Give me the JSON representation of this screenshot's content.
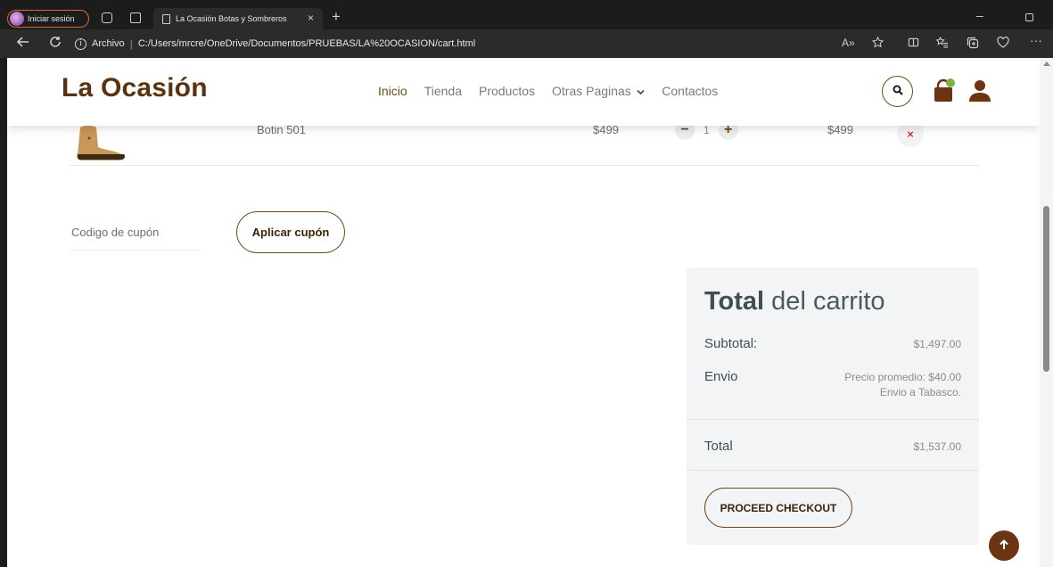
{
  "browser": {
    "profile_label": "Iniciar sesión",
    "tab_title": "La Ocasión Botas y Sombreros",
    "tab_close": "×",
    "new_tab": "+",
    "url_badge": "Archivo",
    "url_separator": "|",
    "url": "C:/Users/mrcre/OneDrive/Documentos/PRUEBAS/LA%20OCASION/cart.html",
    "read_aloud": "A»",
    "minimize": "–"
  },
  "header": {
    "logo": "La Ocasión",
    "nav": [
      {
        "label": "Inicio"
      },
      {
        "label": "Tienda"
      },
      {
        "label": "Productos"
      },
      {
        "label": "Otras Paginas"
      },
      {
        "label": "Contactos"
      }
    ]
  },
  "cart": {
    "items": [
      {
        "name": "Botin 501",
        "price": "$499",
        "quantity": "1",
        "total": "$499"
      }
    ],
    "qty_minus": "−",
    "qty_plus": "+",
    "remove": "×"
  },
  "coupon": {
    "placeholder": "Codigo de cupón",
    "apply_label": "Aplicar cupón"
  },
  "totals": {
    "title_bold": "Total",
    "title_rest": " del carrito",
    "subtotal_label": "Subtotal:",
    "subtotal_value": "$1,497.00",
    "shipping_label": "Envio",
    "shipping_line1": "Precio promedio: $40.00",
    "shipping_line2": "Envio a Tabasco.",
    "total_label": "Total",
    "total_value": "$1,537.00",
    "checkout_label": "PROCEED CHECKOUT"
  },
  "colors": {
    "brand": "#5a3210",
    "accent": "#6b4a1e",
    "back_to_top": "#6b3412",
    "remove": "#d32f2f"
  },
  "icons": [
    "search-icon",
    "shopping-bag-icon",
    "user-icon",
    "remove-icon",
    "arrow-up-icon",
    "info-icon",
    "back-icon",
    "reload-icon"
  ]
}
